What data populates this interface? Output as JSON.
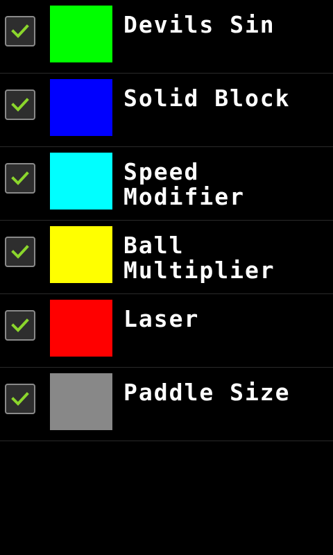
{
  "powerups": [
    {
      "label": "Devils Sin",
      "color": "#00ff00",
      "checked": true
    },
    {
      "label": "Solid Block",
      "color": "#0000ff",
      "checked": true
    },
    {
      "label": "Speed\nModifier",
      "color": "#00ffff",
      "checked": true
    },
    {
      "label": "Ball\nMultiplier",
      "color": "#ffff00",
      "checked": true
    },
    {
      "label": "Laser",
      "color": "#ff0000",
      "checked": true
    },
    {
      "label": "Paddle Size",
      "color": "#888888",
      "checked": true
    }
  ],
  "checkmark_icon": "checkmark-icon",
  "accent_check_color": "#8bd62c"
}
